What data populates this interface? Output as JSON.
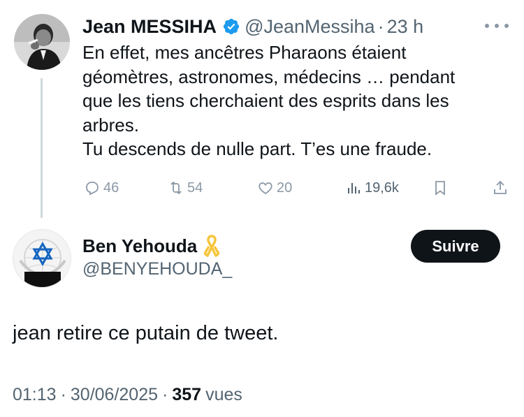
{
  "tweet1": {
    "author_name": "Jean MESSIHA",
    "handle": "@JeanMessiha",
    "separator": "·",
    "time": "23 h",
    "text_lines": [
      "En effet, mes ancêtres Pharaons étaient",
      "géomètres, astronomes, médecins … pendant",
      "que les tiens cherchaient des esprits dans les",
      "arbres.",
      "Tu descends de nulle part. T’es une fraude."
    ],
    "replies": "46",
    "reposts": "54",
    "likes": "20",
    "views": "19,6k",
    "icons": {
      "verified": "verified-badge-icon",
      "more": "more-icon",
      "reply": "reply-icon",
      "repost": "repost-icon",
      "like": "heart-icon",
      "views": "views-icon",
      "bookmark": "bookmark-icon",
      "share": "share-icon"
    },
    "colors": {
      "verified": "#1d9bf0",
      "muted": "#536471"
    }
  },
  "tweet2": {
    "author_name": "Ben Yehouda",
    "handle": "@BENYEHOUDA_",
    "follow_label": "Suivre",
    "text": "jean retire ce putain de tweet.",
    "time": "01:13",
    "separator": "·",
    "date": "30/06/2025",
    "views_count": "357",
    "views_label": "vues",
    "icons": {
      "ribbon": "yellow-ribbon-icon"
    },
    "colors": {
      "ribbon": "#f6c53b",
      "button_bg": "#0f1419"
    }
  }
}
